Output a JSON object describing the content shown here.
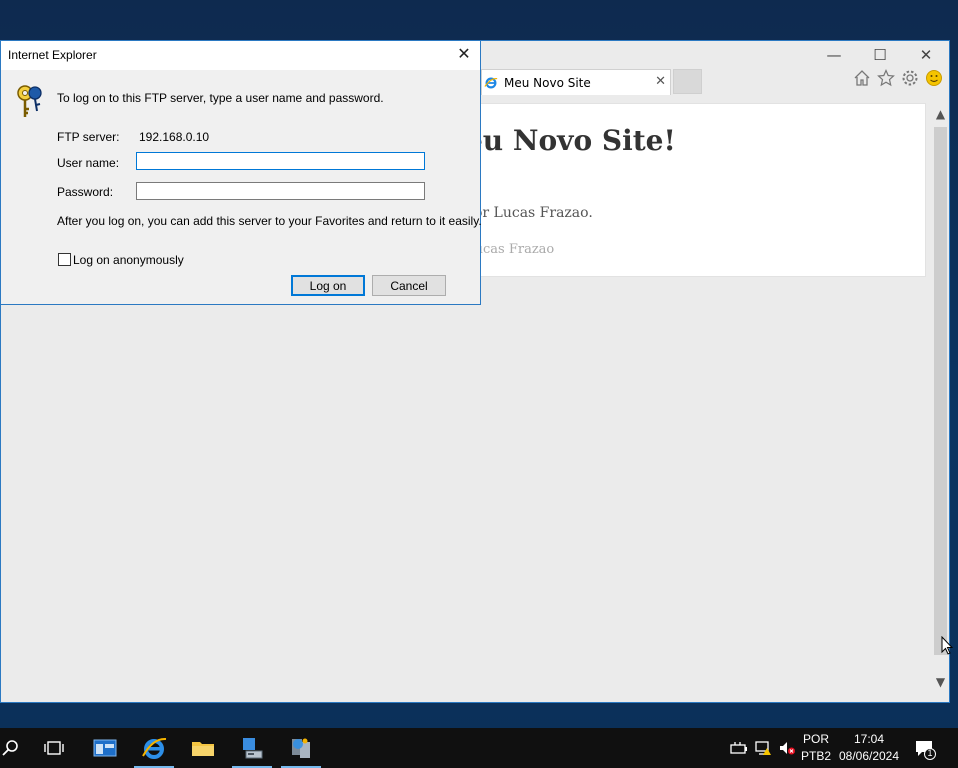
{
  "browser": {
    "tab_title": "Meu Novo Site",
    "page_heading": "Meu Novo Site!",
    "byline": "por Lucas Frazao.",
    "footer": "Lucas Frazao"
  },
  "dialog": {
    "title": "Internet Explorer",
    "prompt": "To log on to this FTP server, type a user name and password.",
    "server_label": "FTP server:",
    "server_value": "192.168.0.10",
    "username_label": "User name:",
    "username_value": "",
    "password_label": "Password:",
    "password_value": "",
    "info": "After you log on, you can add this server to your Favorites and return to it easily.",
    "anonymous_label": "Log on anonymously",
    "anonymous_checked": false,
    "logon_button": "Log on",
    "cancel_button": "Cancel"
  },
  "taskbar": {
    "language": "POR",
    "keyboard": "PTB2",
    "time": "17:04",
    "date": "08/06/2024",
    "notification_count": "1"
  },
  "colors": {
    "accent": "#0078d7",
    "window_border": "#2b79c2",
    "taskbar": "#101010"
  }
}
